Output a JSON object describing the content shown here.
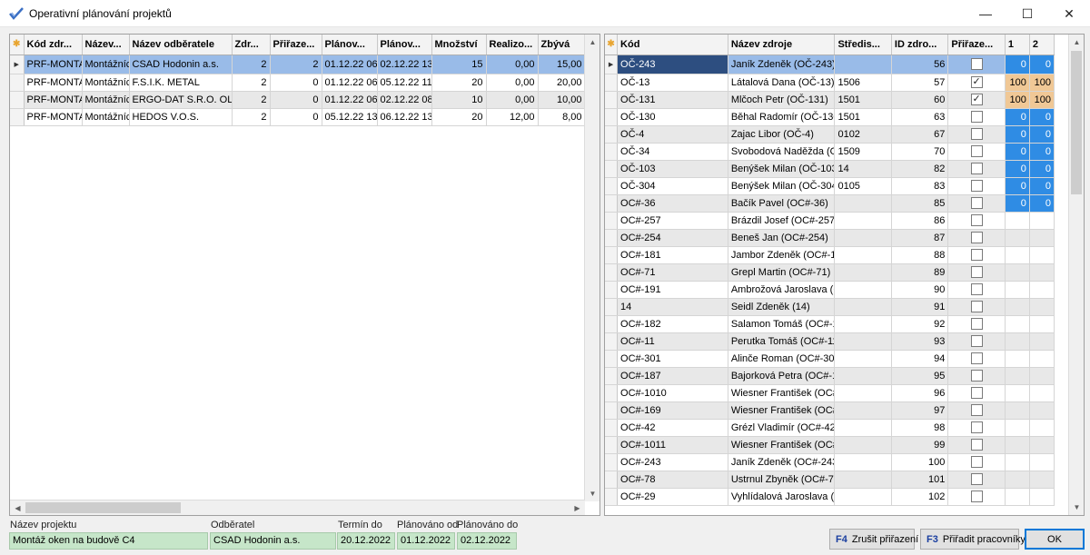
{
  "window": {
    "title": "Operativní plánování projektů",
    "minimize": "—",
    "maximize": "☐",
    "close": "✕"
  },
  "left_grid": {
    "headers": [
      "Kód zdr...",
      "Název...",
      "Název odběratele",
      "Zdr...",
      "Přiřaze...",
      "Plánov...",
      "Plánov...",
      "Množství",
      "Realizo...",
      "Zbývá"
    ],
    "rows": [
      [
        "PRF-MONTAZ",
        "Montážníci",
        "CSAD Hodonin a.s.",
        "2",
        "2",
        "01.12.22 06",
        "02.12.22 13",
        "15",
        "0,00",
        "15,00"
      ],
      [
        "PRF-MONTAZ",
        "Montážníci",
        "F.S.I.K. METAL",
        "2",
        "0",
        "01.12.22 06",
        "05.12.22 11",
        "20",
        "0,00",
        "20,00"
      ],
      [
        "PRF-MONTAZ",
        "Montážníci",
        "ERGO-DAT S.R.O. OLOM",
        "2",
        "0",
        "01.12.22 06",
        "02.12.22 08",
        "10",
        "0,00",
        "10,00"
      ],
      [
        "PRF-MONTAZ",
        "Montážníci",
        "HEDOS V.O.S.",
        "2",
        "0",
        "05.12.22 13",
        "06.12.22 13",
        "20",
        "12,00",
        "8,00"
      ]
    ]
  },
  "right_grid": {
    "headers": [
      "Kód",
      "Název zdroje",
      "Středis...",
      "ID zdro...",
      "Přiřaze...",
      "1",
      "2"
    ],
    "rows": [
      {
        "kod": "OČ-243",
        "nazev": "Janík Zdeněk (OČ-243)",
        "stredisko": "",
        "id": "56",
        "checked": false,
        "c1": "0",
        "c2": "0",
        "color": "blue"
      },
      {
        "kod": "OČ-13",
        "nazev": "Látalová Dana (OČ-13)",
        "stredisko": "1506",
        "id": "57",
        "checked": true,
        "c1": "100",
        "c2": "100",
        "color": "orange"
      },
      {
        "kod": "OČ-131",
        "nazev": "Mlčoch Petr (OČ-131)",
        "stredisko": "1501",
        "id": "60",
        "checked": true,
        "c1": "100",
        "c2": "100",
        "color": "orange"
      },
      {
        "kod": "OČ-130",
        "nazev": "Běhal Radomír (OČ-130)",
        "stredisko": "1501",
        "id": "63",
        "checked": false,
        "c1": "0",
        "c2": "0",
        "color": "blue"
      },
      {
        "kod": "OČ-4",
        "nazev": "Zajac Libor (OČ-4)",
        "stredisko": "0102",
        "id": "67",
        "checked": false,
        "c1": "0",
        "c2": "0",
        "color": "blue"
      },
      {
        "kod": "OČ-34",
        "nazev": "Svobodová Naděžda (OČ",
        "stredisko": "1509",
        "id": "70",
        "checked": false,
        "c1": "0",
        "c2": "0",
        "color": "blue"
      },
      {
        "kod": "OČ-103",
        "nazev": "Benýšek Milan (OČ-103)",
        "stredisko": "14",
        "id": "82",
        "checked": false,
        "c1": "0",
        "c2": "0",
        "color": "blue"
      },
      {
        "kod": "OČ-304",
        "nazev": "Benýšek Milan (OČ-304)",
        "stredisko": "0105",
        "id": "83",
        "checked": false,
        "c1": "0",
        "c2": "0",
        "color": "blue"
      },
      {
        "kod": "OC#-36",
        "nazev": "Bačík Pavel (OC#-36)",
        "stredisko": "",
        "id": "85",
        "checked": false,
        "c1": "0",
        "c2": "0",
        "color": "blue"
      },
      {
        "kod": "OC#-257",
        "nazev": "Brázdil Josef (OC#-257)",
        "stredisko": "",
        "id": "86",
        "checked": false,
        "c1": "",
        "c2": "",
        "color": ""
      },
      {
        "kod": "OC#-254",
        "nazev": "Beneš Jan (OC#-254)",
        "stredisko": "",
        "id": "87",
        "checked": false,
        "c1": "",
        "c2": "",
        "color": ""
      },
      {
        "kod": "OC#-181",
        "nazev": "Jambor Zdeněk (OC#-18",
        "stredisko": "",
        "id": "88",
        "checked": false,
        "c1": "",
        "c2": "",
        "color": ""
      },
      {
        "kod": "OC#-71",
        "nazev": "Grepl Martin (OC#-71)",
        "stredisko": "",
        "id": "89",
        "checked": false,
        "c1": "",
        "c2": "",
        "color": ""
      },
      {
        "kod": "OC#-191",
        "nazev": "Ambrožová Jaroslava (O(",
        "stredisko": "",
        "id": "90",
        "checked": false,
        "c1": "",
        "c2": "",
        "color": ""
      },
      {
        "kod": "14",
        "nazev": "Seidl Zdeněk (14)",
        "stredisko": "",
        "id": "91",
        "checked": false,
        "c1": "",
        "c2": "",
        "color": ""
      },
      {
        "kod": "OC#-182",
        "nazev": "Salamon Tomáš (OC#-18",
        "stredisko": "",
        "id": "92",
        "checked": false,
        "c1": "",
        "c2": "",
        "color": ""
      },
      {
        "kod": "OC#-11",
        "nazev": "Perutka Tomáš (OC#-11)",
        "stredisko": "",
        "id": "93",
        "checked": false,
        "c1": "",
        "c2": "",
        "color": ""
      },
      {
        "kod": "OC#-301",
        "nazev": "Alinče Roman (OC#-301",
        "stredisko": "",
        "id": "94",
        "checked": false,
        "c1": "",
        "c2": "",
        "color": ""
      },
      {
        "kod": "OC#-187",
        "nazev": "Bajorková Petra (OC#-1",
        "stredisko": "",
        "id": "95",
        "checked": false,
        "c1": "",
        "c2": "",
        "color": ""
      },
      {
        "kod": "OC#-1010",
        "nazev": "Wiesner František (OC#-",
        "stredisko": "",
        "id": "96",
        "checked": false,
        "c1": "",
        "c2": "",
        "color": ""
      },
      {
        "kod": "OC#-169",
        "nazev": "Wiesner František (OC#-",
        "stredisko": "",
        "id": "97",
        "checked": false,
        "c1": "",
        "c2": "",
        "color": ""
      },
      {
        "kod": "OC#-42",
        "nazev": "Grézl Vladimír (OC#-42)",
        "stredisko": "",
        "id": "98",
        "checked": false,
        "c1": "",
        "c2": "",
        "color": ""
      },
      {
        "kod": "OC#-1011",
        "nazev": "Wiesner František (OC#-",
        "stredisko": "",
        "id": "99",
        "checked": false,
        "c1": "",
        "c2": "",
        "color": ""
      },
      {
        "kod": "OC#-243",
        "nazev": "Janík Zdeněk (OC#-243)",
        "stredisko": "",
        "id": "100",
        "checked": false,
        "c1": "",
        "c2": "",
        "color": ""
      },
      {
        "kod": "OC#-78",
        "nazev": "Ustrnul Zbyněk (OC#-78)",
        "stredisko": "",
        "id": "101",
        "checked": false,
        "c1": "",
        "c2": "",
        "color": ""
      },
      {
        "kod": "OC#-29",
        "nazev": "Vyhlídalová Jaroslava (O(",
        "stredisko": "",
        "id": "102",
        "checked": false,
        "c1": "",
        "c2": "",
        "color": ""
      }
    ]
  },
  "footer": {
    "labels": {
      "nazev_projektu": "Název projektu",
      "odberatel": "Odběratel",
      "termin_do": "Termín do",
      "planovano_od": "Plánováno od",
      "planovano_do": "Plánováno do"
    },
    "values": {
      "nazev_projektu": "Montáž oken na budově C4",
      "odberatel": "CSAD Hodonin a.s.",
      "termin_do": "20.12.2022",
      "planovano_od": "01.12.2022",
      "planovano_do": "02.12.2022"
    },
    "buttons": {
      "zrusit_key": "F4",
      "zrusit_label": "Zrušit přiřazení",
      "priradit_key": "F3",
      "priradit_label": "Přiřadit pracovníky",
      "ok_label": "OK"
    }
  },
  "colors": {
    "selected_row": "#99bbe8",
    "alt_row": "#e8e8e8",
    "blue_cell": "#2f8ce4",
    "orange_cell": "#f0c896",
    "footer_field": "#c6e6c9"
  }
}
